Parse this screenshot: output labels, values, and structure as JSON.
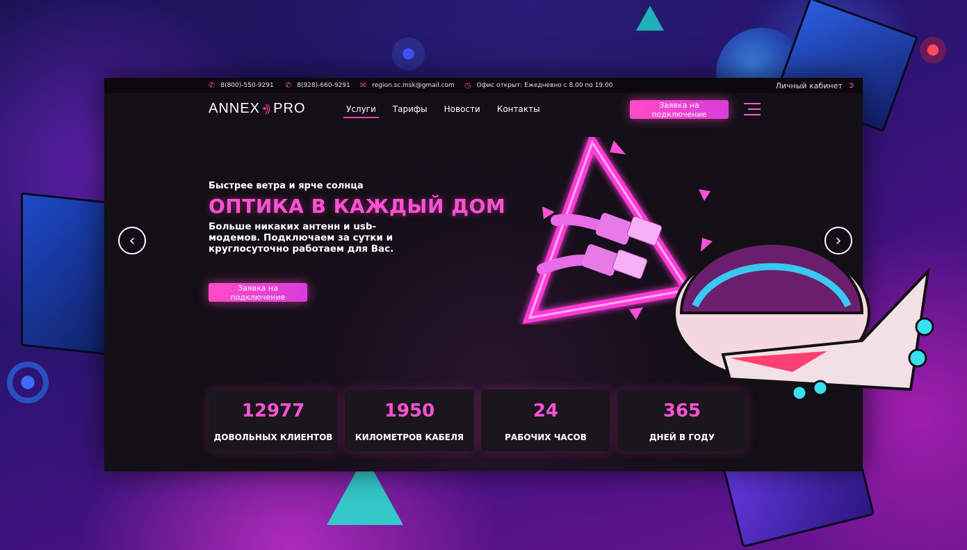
{
  "topbar": {
    "phone1": "8(800)-550-9291",
    "phone2": "8(928)-660-9291",
    "email": "region.sc.msk@gmail.com",
    "hours": "Офис открыт: Ежедневно с 8.00 по 19.00",
    "cabinet": "Личный кабинет"
  },
  "logo": {
    "main": "ANNEX",
    "suffix": "PRO"
  },
  "menu": [
    {
      "label": "Услуги",
      "active": true
    },
    {
      "label": "Тарифы",
      "active": false
    },
    {
      "label": "Новости",
      "active": false
    },
    {
      "label": "Контакты",
      "active": false
    }
  ],
  "nav_button": "Заявка на подключение",
  "hero": {
    "subtitle": "Быстрее ветра и ярче солнца",
    "title": "ОПТИКА В КАЖДЫЙ ДОМ",
    "text": "Больше никаких антенн и usb-модемов. Подключаем за сутки и круглосуточно работаем для Вас.",
    "button": "Заявка на подключение"
  },
  "stats": [
    {
      "value": "12977",
      "label": "ДОВОЛЬНЫХ КЛИЕНТОВ"
    },
    {
      "value": "1950",
      "label": "КИЛОМЕТРОВ КАБЕЛЯ"
    },
    {
      "value": "24",
      "label": "РАБОЧИХ ЧАСОВ"
    },
    {
      "value": "365",
      "label": "ДНЕЙ В ГОДУ"
    }
  ],
  "colors": {
    "accent": "#ff52d2",
    "button": "#ff4bc8",
    "site_bg": "#130f16"
  },
  "icons": {
    "phone": "phone-icon",
    "email": "mail-icon",
    "clock": "clock-icon",
    "login": "login-icon",
    "menu": "hamburger-icon",
    "prev": "chevron-left-icon",
    "next": "chevron-right-icon"
  }
}
